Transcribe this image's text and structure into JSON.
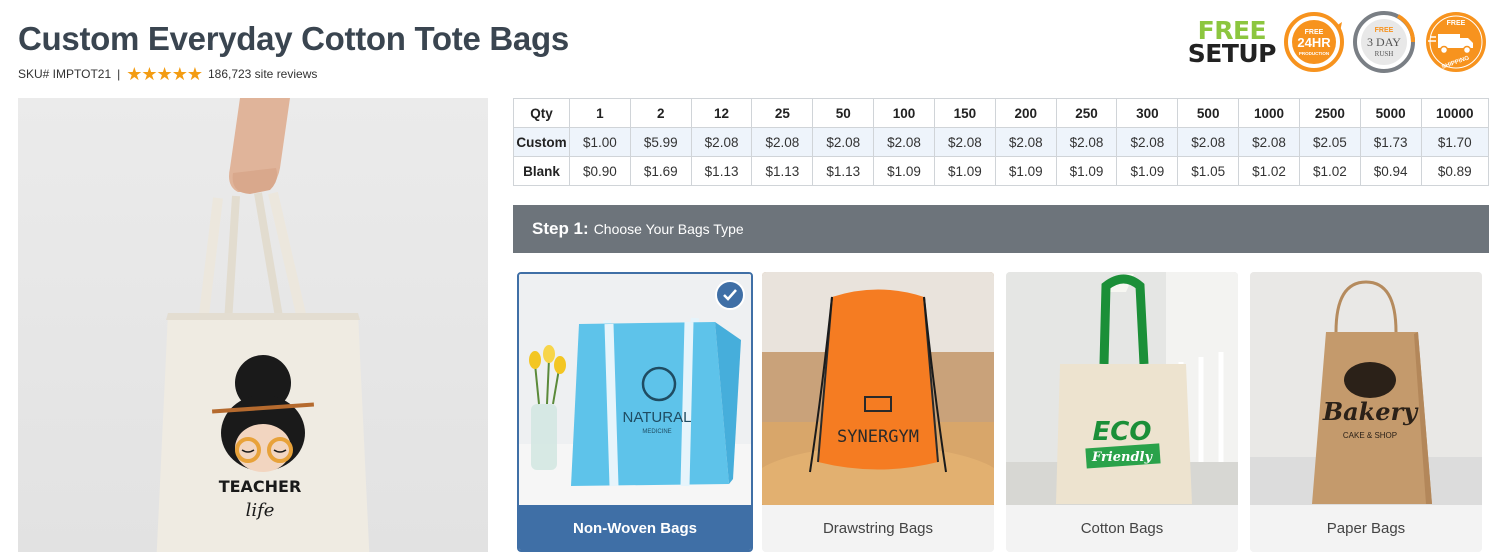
{
  "product": {
    "title": "Custom Everyday Cotton Tote Bags",
    "sku": "SKU# IMPTOT21",
    "separator": "|",
    "rating_stars": 5,
    "reviews": "186,723 site reviews"
  },
  "badges": {
    "free_setup_line1": "FREE",
    "free_setup_line2": "SETUP",
    "production": {
      "top": "FREE",
      "main": "24HR",
      "bottom": "PRODUCTION"
    },
    "rush": {
      "top": "FREE",
      "main": "3 DAY",
      "bottom": "RUSH"
    },
    "shipping": {
      "top": "FREE",
      "bottom": "SHIPPING"
    }
  },
  "product_image": {
    "print_line1": "TEACHER",
    "print_line2": "life"
  },
  "pricing": {
    "header_label": "Qty",
    "quantities": [
      "1",
      "2",
      "12",
      "25",
      "50",
      "100",
      "150",
      "200",
      "250",
      "300",
      "500",
      "1000",
      "2500",
      "5000",
      "10000"
    ],
    "rows": [
      {
        "label": "Custom",
        "prices": [
          "$1.00",
          "$5.99",
          "$2.08",
          "$2.08",
          "$2.08",
          "$2.08",
          "$2.08",
          "$2.08",
          "$2.08",
          "$2.08",
          "$2.08",
          "$2.08",
          "$2.05",
          "$1.73",
          "$1.70"
        ]
      },
      {
        "label": "Blank",
        "prices": [
          "$0.90",
          "$1.69",
          "$1.13",
          "$1.13",
          "$1.13",
          "$1.09",
          "$1.09",
          "$1.09",
          "$1.09",
          "$1.09",
          "$1.05",
          "$1.02",
          "$1.02",
          "$0.94",
          "$0.89"
        ]
      }
    ]
  },
  "step1": {
    "number": "Step 1:",
    "text": "Choose Your Bags Type"
  },
  "bag_types": [
    {
      "label": "Non-Woven Bags",
      "selected": true,
      "print": "NATURAL",
      "print_sub": "MEDICINE"
    },
    {
      "label": "Drawstring Bags",
      "selected": false,
      "print": "SYNERGYM"
    },
    {
      "label": "Cotton Bags",
      "selected": false,
      "print": "ECO",
      "print_sub": "Friendly"
    },
    {
      "label": "Paper Bags",
      "selected": false,
      "print": "Bakery",
      "print_sub": "CAKE & SHOP"
    }
  ],
  "colors": {
    "title": "#3a4550",
    "star": "#f39c12",
    "step_bar": "#6d747b",
    "selected": "#3f6fa6",
    "badge_orange": "#f7931e",
    "free_green": "#8cc63f"
  }
}
